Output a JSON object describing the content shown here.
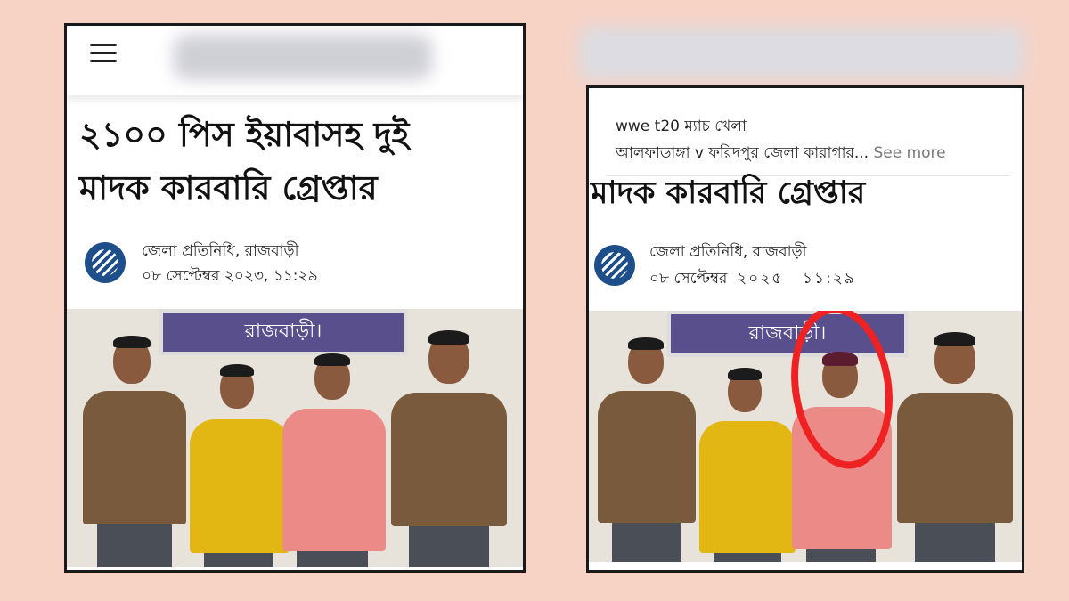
{
  "left": {
    "headline_line1": "২১০০ পিস ইয়াবাসহ দুই",
    "headline_line2": "মাদক কারবারি গ্রেপ্তার",
    "author": "জেলা প্রতিনিধি, রাজবাড়ী",
    "date": "০৮ সেপ্টেম্বর ২০২৩, ১১:২৯",
    "banner": "রাজবাড়ী।",
    "icons": [
      "menu-icon",
      "publisher-logo-icon"
    ]
  },
  "right": {
    "fb_line1": "wwe t20  ম্যাচ খেলা",
    "fb_line2": "আলফাডাঙ্গা v ফরিদপুর জেলা কারাগার...",
    "fb_see_more": "See more",
    "headline_line2": "মাদক কারবারি গ্রেপ্তার",
    "author": "জেলা প্রতিনিধি, রাজবাড়ী",
    "date_prefix": "০৮ সেপ্টেম্বর",
    "date_year": "২০২৫",
    "date_time": "১১:২৯",
    "banner": "রাজবাড়ী।",
    "highlight_color": "#ee2222"
  },
  "colors": {
    "background": "#f7d3c6",
    "banner": "#584f8c",
    "vest": "#7a5a3c",
    "shirt_yellow": "#e2b714",
    "shirt_pink": "#ec8a87"
  }
}
